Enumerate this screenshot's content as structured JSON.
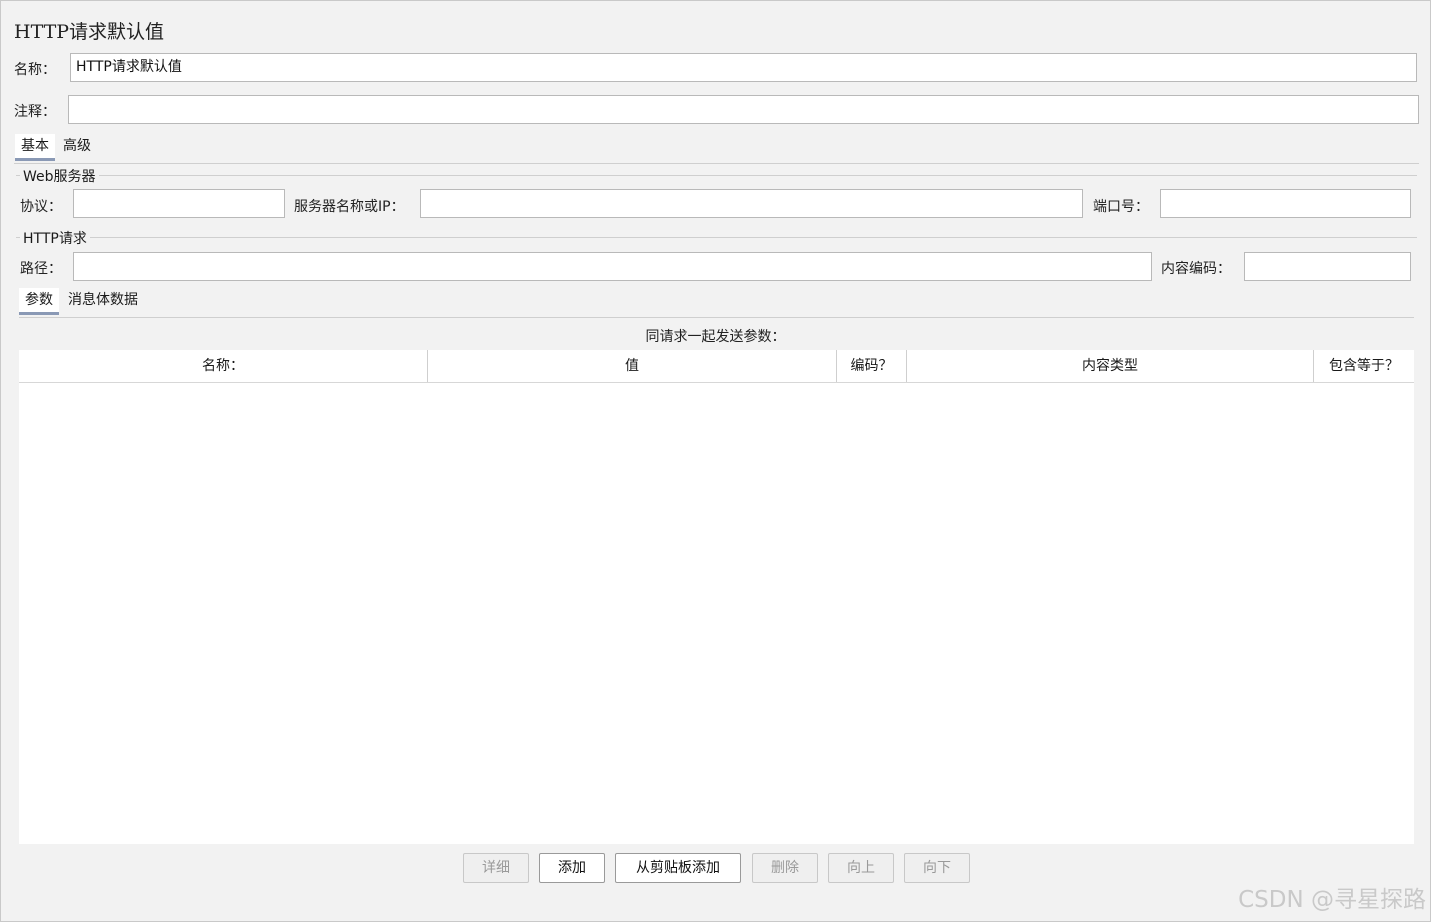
{
  "window": {
    "title": "HTTP请求默认值"
  },
  "name_field": {
    "label": "名称：",
    "value": "HTTP请求默认值"
  },
  "comment_field": {
    "label": "注释：",
    "value": ""
  },
  "main_tabs": [
    {
      "label": "基本",
      "active": true
    },
    {
      "label": "高级",
      "active": false
    }
  ],
  "web_server": {
    "group_title": "Web服务器",
    "protocol_label": "协议：",
    "protocol_value": "",
    "server_label": "服务器名称或IP：",
    "server_value": "",
    "port_label": "端口号：",
    "port_value": ""
  },
  "http_request": {
    "group_title": "HTTP请求",
    "path_label": "路径：",
    "path_value": "",
    "encoding_label": "内容编码：",
    "encoding_value": ""
  },
  "param_tabs": [
    {
      "label": "参数",
      "active": true
    },
    {
      "label": "消息体数据",
      "active": false
    }
  ],
  "params_table": {
    "caption": "同请求一起发送参数：",
    "columns": [
      "名称：",
      "值",
      "编码？",
      "内容类型",
      "包含等于？"
    ],
    "rows": []
  },
  "buttons": {
    "detail": "详细",
    "add": "添加",
    "add_clipboard": "从剪贴板添加",
    "delete": "删除",
    "up": "向上",
    "down": "向下"
  },
  "watermark": "CSDN @寻星探路"
}
